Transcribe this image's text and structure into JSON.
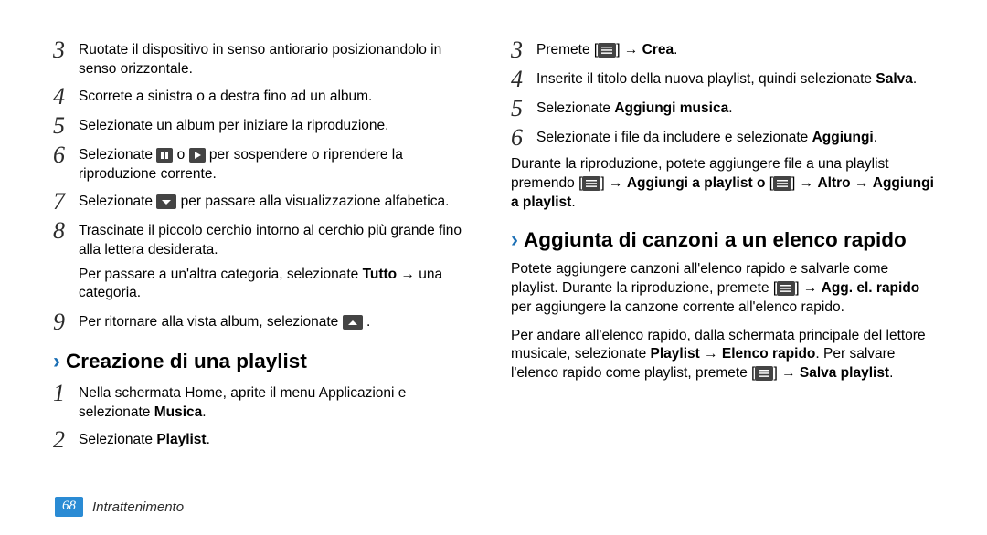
{
  "left": {
    "steps": [
      {
        "n": "3",
        "body": "Ruotate il dispositivo in senso antiorario posizionandolo in senso orizzontale."
      },
      {
        "n": "4",
        "body": "Scorrete a sinistra o a destra fino ad un album."
      },
      {
        "n": "5",
        "body": "Selezionate un album per iniziare la riproduzione."
      },
      {
        "n": "6",
        "pre": "Selezionate ",
        "mid": " o ",
        "post": " per sospendere o riprendere la riproduzione corrente."
      },
      {
        "n": "7",
        "pre": "Selezionate ",
        "post": " per passare alla visualizzazione alfabetica."
      },
      {
        "n": "8",
        "body": "Trascinate il piccolo cerchio intorno al cerchio più grande fino alla lettera desiderata."
      }
    ],
    "note8a": "Per passare a un'altra categoria, selezionate ",
    "note8b": "Tutto",
    "note8c": " → una categoria.",
    "step9": {
      "n": "9",
      "pre": "Per ritornare alla vista album, selezionate ",
      "post": "."
    },
    "heading": "Creazione di una playlist",
    "step1": {
      "n": "1",
      "pre": "Nella schermata Home, aprite il menu Applicazioni e selezionate ",
      "bold": "Musica",
      "post": "."
    },
    "step2": {
      "n": "2",
      "pre": "Selezionate ",
      "bold": "Playlist",
      "post": "."
    }
  },
  "right": {
    "step3": {
      "n": "3",
      "pre": "Premete [",
      "mid": "] → ",
      "bold": "Crea",
      "post": "."
    },
    "step4": {
      "n": "4",
      "pre": "Inserite il titolo della nuova playlist, quindi selezionate ",
      "bold": "Salva",
      "post": "."
    },
    "step5": {
      "n": "5",
      "pre": "Selezionate ",
      "bold": "Aggiungi musica",
      "post": "."
    },
    "step6": {
      "n": "6",
      "pre": "Selezionate i file da includere e selezionate ",
      "bold": "Aggiungi",
      "post": "."
    },
    "para1a": "Durante la riproduzione, potete aggiungere file a una playlist premendo [",
    "para1b": "] → ",
    "para1bold1": "Aggiungi a playlist o",
    "para1c": " [",
    "para1d": "] → ",
    "para1bold2": "Altro",
    "para1e": " → ",
    "para1bold3": "Aggiungi a playlist",
    "para1f": ".",
    "heading": "Aggiunta di canzoni a un elenco rapido",
    "para2a": "Potete aggiungere canzoni all'elenco rapido e salvarle come playlist. Durante la riproduzione, premete [",
    "para2b": "] → ",
    "para2bold1": "Agg. el. rapido",
    "para2c": " per aggiungere la canzone corrente all'elenco rapido.",
    "para3a": "Per andare all'elenco rapido, dalla schermata principale del lettore musicale, selezionate ",
    "para3bold1": "Playlist",
    "para3b": " → ",
    "para3bold2": "Elenco rapido",
    "para3c": ". Per salvare l'elenco rapido come playlist, premete [",
    "para3d": "] → ",
    "para3bold3": "Salva playlist",
    "para3e": "."
  },
  "footer": {
    "page": "68",
    "section": "Intrattenimento"
  }
}
